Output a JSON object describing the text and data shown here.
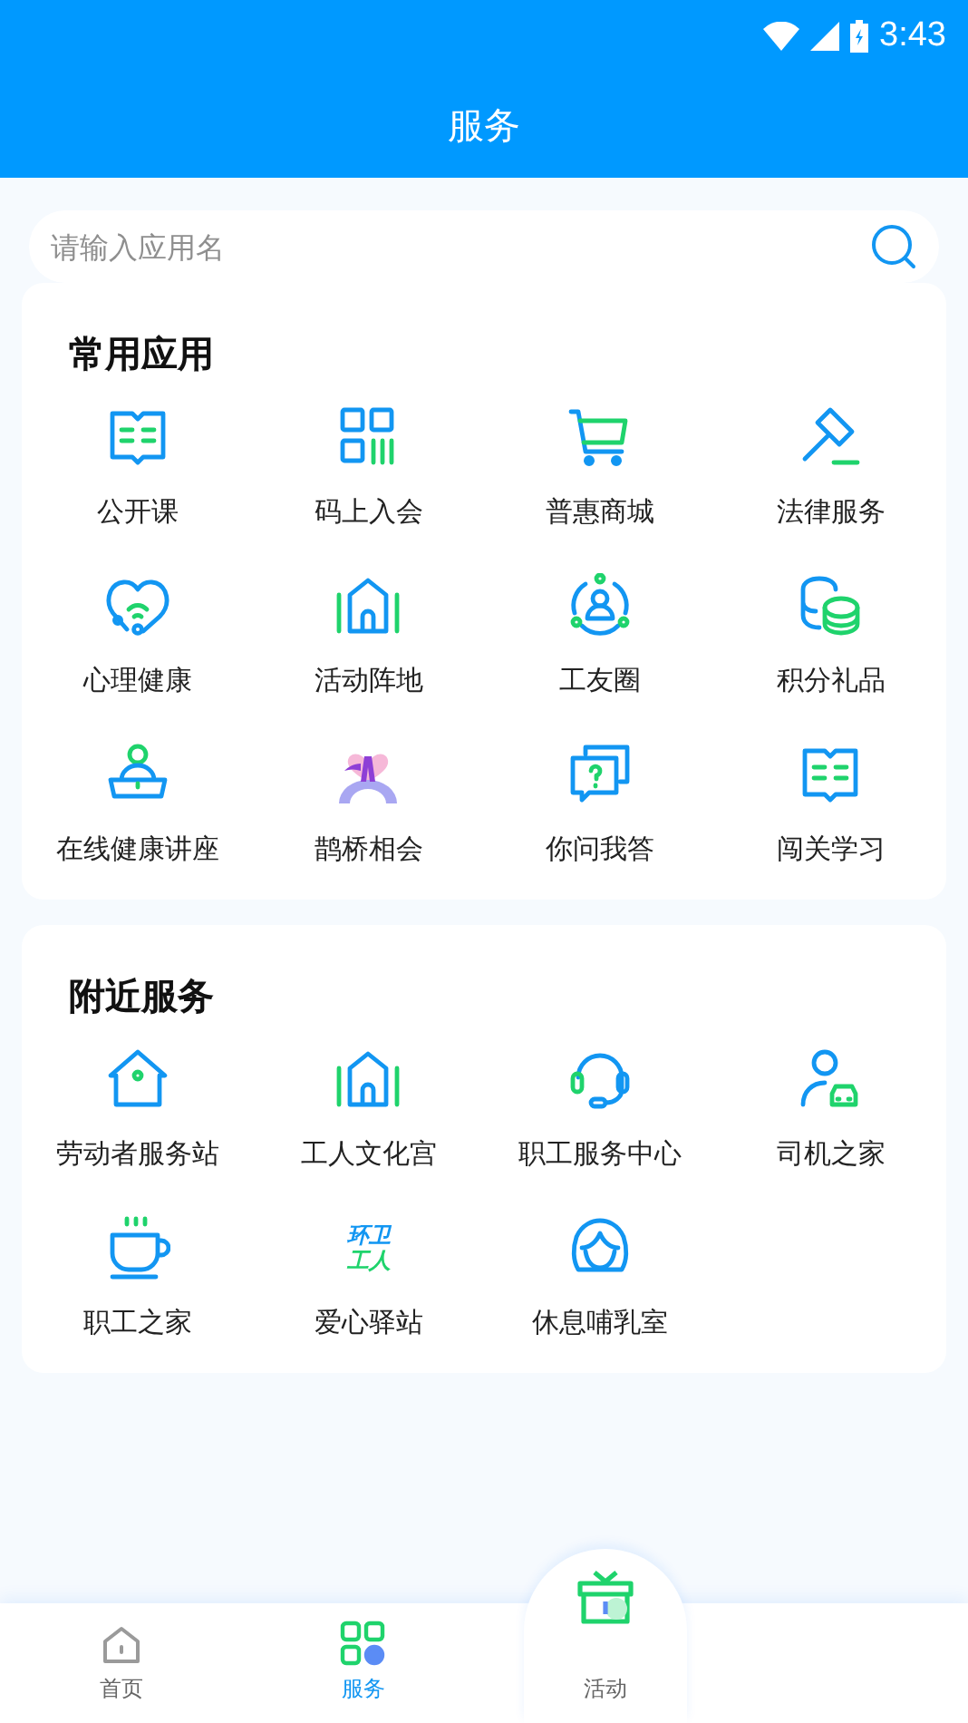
{
  "status_bar": {
    "time": "3:43"
  },
  "header": {
    "title": "服务"
  },
  "search": {
    "placeholder": "请输入应用名"
  },
  "sections": [
    {
      "title": "常用应用",
      "items": [
        {
          "label": "公开课",
          "kind": "book"
        },
        {
          "label": "码上入会",
          "kind": "qr"
        },
        {
          "label": "普惠商城",
          "kind": "cart"
        },
        {
          "label": "法律服务",
          "kind": "gavel"
        },
        {
          "label": "心理健康",
          "kind": "heart"
        },
        {
          "label": "活动阵地",
          "kind": "hall"
        },
        {
          "label": "工友圈",
          "kind": "circle"
        },
        {
          "label": "积分礼品",
          "kind": "coins"
        },
        {
          "label": "在线健康讲座",
          "kind": "lecture"
        },
        {
          "label": "鹊桥相会",
          "kind": "bridge"
        },
        {
          "label": "你问我答",
          "kind": "chat"
        },
        {
          "label": "闯关学习",
          "kind": "book"
        }
      ]
    },
    {
      "title": "附近服务",
      "items": [
        {
          "label": "劳动者服务站",
          "kind": "home"
        },
        {
          "label": "工人文化宫",
          "kind": "hall"
        },
        {
          "label": "职工服务中心",
          "kind": "headset"
        },
        {
          "label": "司机之家",
          "kind": "driver"
        },
        {
          "label": "职工之家",
          "kind": "cup"
        },
        {
          "label": "爱心驿站",
          "kind": "wordmark",
          "icon_text": [
            "环卫",
            "工人"
          ]
        },
        {
          "label": "休息哺乳室",
          "kind": "woman"
        }
      ]
    }
  ],
  "tabbar": [
    {
      "label": "首页",
      "kind": "home",
      "selected": false
    },
    {
      "label": "服务",
      "kind": "grid",
      "selected": true
    },
    {
      "label": "活动",
      "kind": "gift",
      "selected": false
    }
  ]
}
